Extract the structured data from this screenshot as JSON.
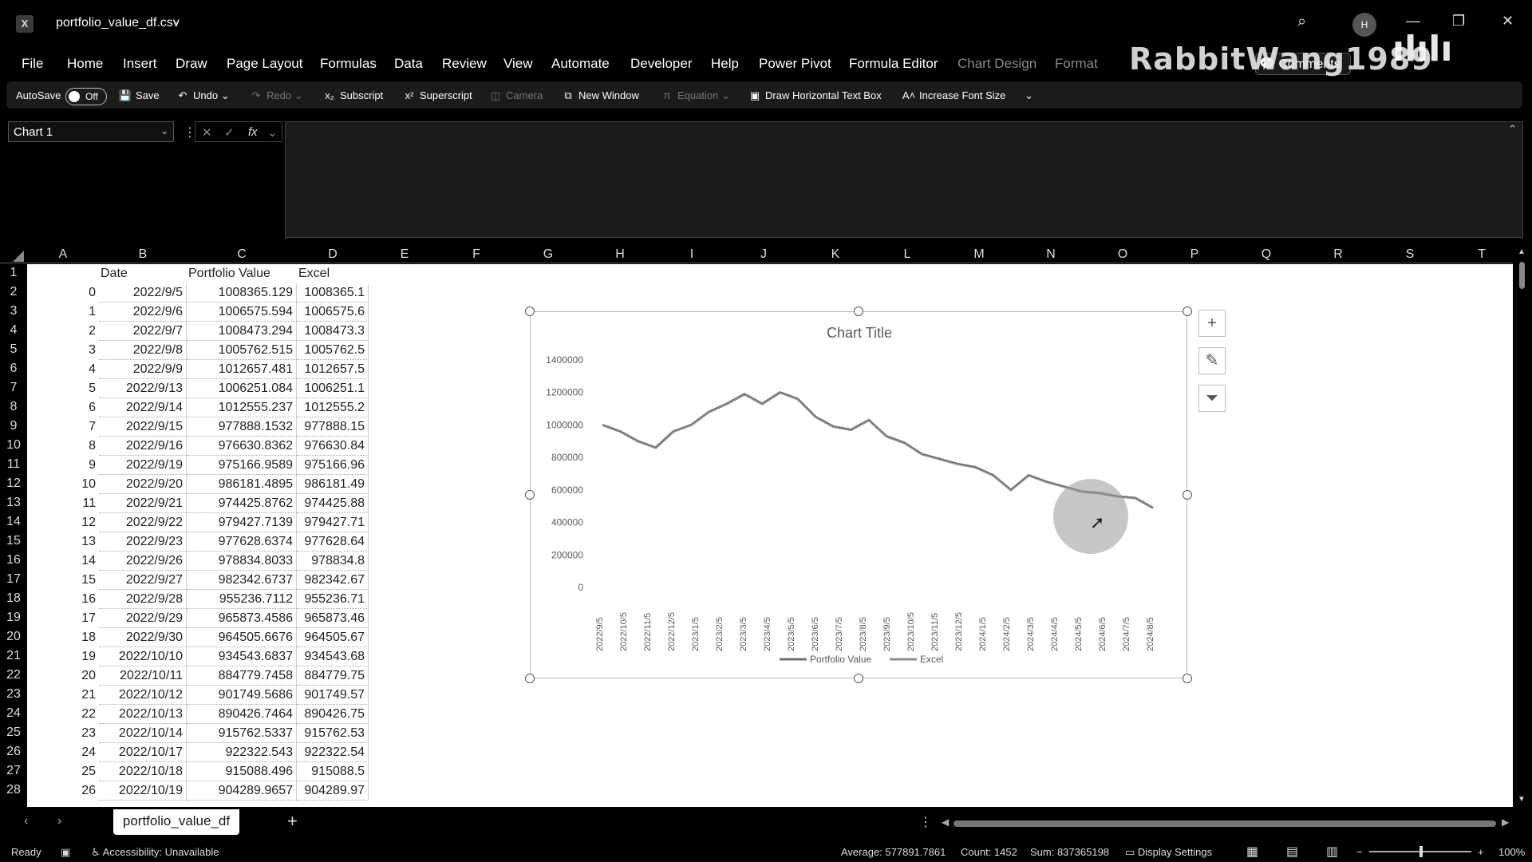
{
  "window": {
    "file_name": "portfolio_value_df.csv",
    "app_icon": "excel-icon",
    "user_initial": "H",
    "watermark_text": "RabbitWang1989",
    "watermark_logo": "bilibili"
  },
  "menu": {
    "items": [
      "File",
      "Home",
      "Insert",
      "Draw",
      "Page Layout",
      "Formulas",
      "Data",
      "Review",
      "View",
      "Automate",
      "Developer",
      "Help",
      "Power Pivot",
      "Formula Editor"
    ],
    "context_items": [
      "Chart Design",
      "Format"
    ],
    "comments_label": "Comments"
  },
  "quick_access": {
    "autosave_label": "AutoSave",
    "autosave_state": "Off",
    "save": "Save",
    "undo": "Undo",
    "redo": "Redo",
    "subscript": "Subscript",
    "superscript": "Superscript",
    "camera": "Camera",
    "new_window": "New Window",
    "equation": "Equation",
    "draw_text_box": "Draw Horizontal Text Box",
    "increase_font": "Increase Font Size"
  },
  "formula_bar": {
    "name_box": "Chart 1",
    "formula": ""
  },
  "columns": [
    "A",
    "B",
    "C",
    "D",
    "E",
    "F",
    "G",
    "H",
    "I",
    "J",
    "K",
    "L",
    "M",
    "N",
    "O",
    "P",
    "Q",
    "R",
    "S",
    "T"
  ],
  "table": {
    "headers": [
      "",
      "Date",
      "Portfolio Value",
      "Excel"
    ],
    "rows": [
      [
        "0",
        "2022/9/5",
        "1008365.129",
        "1008365.1"
      ],
      [
        "1",
        "2022/9/6",
        "1006575.594",
        "1006575.6"
      ],
      [
        "2",
        "2022/9/7",
        "1008473.294",
        "1008473.3"
      ],
      [
        "3",
        "2022/9/8",
        "1005762.515",
        "1005762.5"
      ],
      [
        "4",
        "2022/9/9",
        "1012657.481",
        "1012657.5"
      ],
      [
        "5",
        "2022/9/13",
        "1006251.084",
        "1006251.1"
      ],
      [
        "6",
        "2022/9/14",
        "1012555.237",
        "1012555.2"
      ],
      [
        "7",
        "2022/9/15",
        "977888.1532",
        "977888.15"
      ],
      [
        "8",
        "2022/9/16",
        "976630.8362",
        "976630.84"
      ],
      [
        "9",
        "2022/9/19",
        "975166.9589",
        "975166.96"
      ],
      [
        "10",
        "2022/9/20",
        "986181.4895",
        "986181.49"
      ],
      [
        "11",
        "2022/9/21",
        "974425.8762",
        "974425.88"
      ],
      [
        "12",
        "2022/9/22",
        "979427.7139",
        "979427.71"
      ],
      [
        "13",
        "2022/9/23",
        "977628.6374",
        "977628.64"
      ],
      [
        "14",
        "2022/9/26",
        "978834.8033",
        "978834.8"
      ],
      [
        "15",
        "2022/9/27",
        "982342.6737",
        "982342.67"
      ],
      [
        "16",
        "2022/9/28",
        "955236.7112",
        "955236.71"
      ],
      [
        "17",
        "2022/9/29",
        "965873.4586",
        "965873.46"
      ],
      [
        "18",
        "2022/9/30",
        "964505.6676",
        "964505.67"
      ],
      [
        "19",
        "2022/10/10",
        "934543.6837",
        "934543.68"
      ],
      [
        "20",
        "2022/10/11",
        "884779.7458",
        "884779.75"
      ],
      [
        "21",
        "2022/10/12",
        "901749.5686",
        "901749.57"
      ],
      [
        "22",
        "2022/10/13",
        "890426.7464",
        "890426.75"
      ],
      [
        "23",
        "2022/10/14",
        "915762.5337",
        "915762.53"
      ],
      [
        "24",
        "2022/10/17",
        "922322.543",
        "922322.54"
      ],
      [
        "25",
        "2022/10/18",
        "915088.496",
        "915088.5"
      ],
      [
        "26",
        "2022/10/19",
        "904289.9657",
        "904289.97"
      ]
    ]
  },
  "chart_data": {
    "type": "line",
    "title": "Chart Title",
    "y_ticks": [
      "0",
      "200000",
      "400000",
      "600000",
      "800000",
      "1000000",
      "1200000",
      "1400000"
    ],
    "ylim": [
      0,
      1400000
    ],
    "x_ticks": [
      "2022/9/5",
      "2022/10/5",
      "2022/11/5",
      "2022/12/5",
      "2023/1/5",
      "2023/2/5",
      "2023/3/5",
      "2023/4/5",
      "2023/5/5",
      "2023/6/5",
      "2023/7/5",
      "2023/8/5",
      "2023/9/5",
      "2023/10/5",
      "2023/11/5",
      "2023/12/5",
      "2024/1/5",
      "2024/2/5",
      "2024/3/5",
      "2024/4/5",
      "2024/5/5",
      "2024/6/5",
      "2024/7/5",
      "2024/8/5"
    ],
    "legend_position": "bottom",
    "series": [
      {
        "name": "Portfolio Value",
        "color": "#6f6f6f",
        "values": [
          1000000,
          960000,
          900000,
          860000,
          960000,
          1000000,
          1080000,
          1130000,
          1190000,
          1130000,
          1200000,
          1160000,
          1050000,
          990000,
          970000,
          1030000,
          930000,
          890000,
          820000,
          790000,
          760000,
          740000,
          690000,
          600000,
          690000,
          650000,
          620000,
          590000,
          580000,
          560000,
          550000,
          490000
        ]
      },
      {
        "name": "Excel",
        "color": "#8e8e8e",
        "values": [
          1000000,
          960000,
          900000,
          860000,
          960000,
          1000000,
          1080000,
          1130000,
          1190000,
          1130000,
          1200000,
          1160000,
          1050000,
          990000,
          970000,
          1030000,
          930000,
          890000,
          820000,
          790000,
          760000,
          740000,
          690000,
          600000,
          690000,
          650000,
          620000,
          590000,
          580000,
          560000,
          550000,
          490000
        ]
      }
    ]
  },
  "sheet_tabs": {
    "active": "portfolio_value_df",
    "add": "+"
  },
  "status": {
    "ready": "Ready",
    "accessibility": "Accessibility: Unavailable",
    "average": "Average: 577891.7861",
    "count": "Count: 1452",
    "sum": "Sum: 837365198",
    "display_settings": "Display Settings",
    "zoom_minus": "−",
    "zoom_plus": "+",
    "zoom": "100%"
  }
}
